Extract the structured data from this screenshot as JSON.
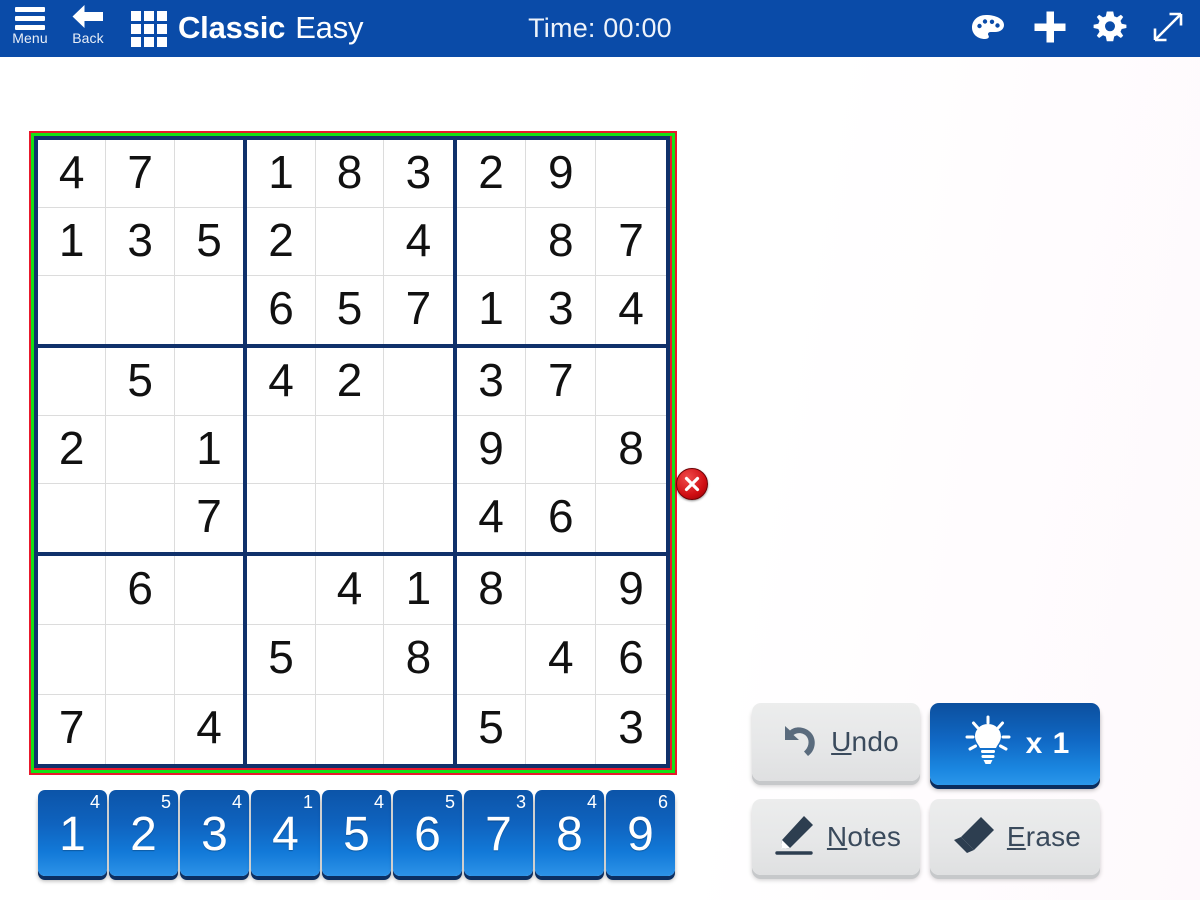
{
  "header": {
    "menu_label": "Menu",
    "back_label": "Back",
    "title_main": "Classic",
    "title_sub": "Easy",
    "timer_label": "Time: 00:00",
    "icons": {
      "menu": "hamburger-icon",
      "back": "back-arrow-icon",
      "app": "sudoku-grid-icon",
      "palette": "palette-icon",
      "add": "plus-icon",
      "settings": "gear-icon",
      "fullscreen": "expand-diagonal-icon"
    },
    "bg_color": "#0a4ba8"
  },
  "board": {
    "outline_outer_color": "#e8192c",
    "outline_inner_color": "#14e114",
    "grid_border_color": "#10316b",
    "cell_line_color": "#dcdcdc",
    "rows": [
      [
        "4",
        "7",
        "",
        "1",
        "8",
        "3",
        "2",
        "9",
        ""
      ],
      [
        "1",
        "3",
        "5",
        "2",
        "",
        "4",
        "",
        "8",
        "7"
      ],
      [
        "",
        "",
        "",
        "6",
        "5",
        "7",
        "1",
        "3",
        "4"
      ],
      [
        "",
        "5",
        "",
        "4",
        "2",
        "",
        "3",
        "7",
        ""
      ],
      [
        "2",
        "",
        "1",
        "",
        "",
        "",
        "9",
        "",
        "8"
      ],
      [
        "",
        "",
        "7",
        "",
        "",
        "",
        "4",
        "6",
        ""
      ],
      [
        "",
        "6",
        "",
        "",
        "4",
        "1",
        "8",
        "",
        "9"
      ],
      [
        "",
        "",
        "",
        "5",
        "",
        "8",
        "",
        "4",
        "6"
      ],
      [
        "7",
        "",
        "4",
        "",
        "",
        "",
        "5",
        "",
        "3"
      ]
    ]
  },
  "close_badge": {
    "name": "close-grid-badge",
    "glyph": "✕",
    "color": "#cf0d12"
  },
  "numpad": [
    {
      "digit": "1",
      "count": "4"
    },
    {
      "digit": "2",
      "count": "5"
    },
    {
      "digit": "3",
      "count": "4"
    },
    {
      "digit": "4",
      "count": "1"
    },
    {
      "digit": "5",
      "count": "4"
    },
    {
      "digit": "6",
      "count": "5"
    },
    {
      "digit": "7",
      "count": "3"
    },
    {
      "digit": "8",
      "count": "4"
    },
    {
      "digit": "9",
      "count": "6"
    }
  ],
  "actions": {
    "undo": {
      "label_accel": "U",
      "label_rest": "ndo",
      "icon": "undo-arrow-icon"
    },
    "hint": {
      "count_label": "x 1",
      "icon": "lightbulb-icon",
      "color": "#1068c4"
    },
    "notes": {
      "label_accel": "N",
      "label_rest": "otes",
      "icon": "pencil-icon"
    },
    "erase": {
      "label_accel": "E",
      "label_rest": "rase",
      "icon": "eraser-icon"
    }
  }
}
